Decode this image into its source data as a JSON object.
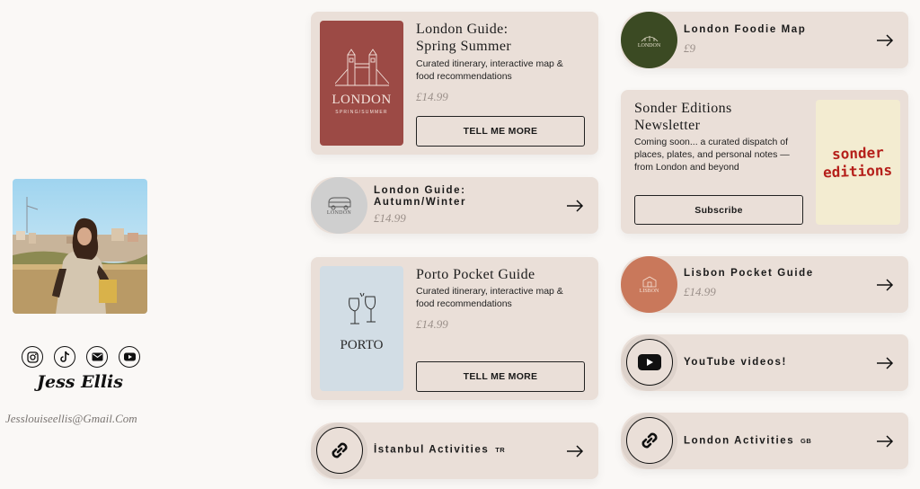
{
  "profile": {
    "name": "Jess Ellis",
    "email": "Jesslouiseellis@Gmail.Com",
    "socials": [
      "instagram-icon",
      "tiktok-icon",
      "email-icon",
      "youtube-icon"
    ]
  },
  "cards": {
    "london_ss": {
      "title_line1": "London Guide:",
      "title_line2": "Spring Summer",
      "description": "Curated itinerary, interactive map & food recommendations",
      "price": "£14.99",
      "button": "TELL ME MORE",
      "image_text": "LONDON",
      "image_subtext": "SPRING/SUMMER"
    },
    "london_aw": {
      "title_line1": "London Guide:",
      "title_line2": "Autumn/Winter",
      "price": "£14.99",
      "image_text": "LONDON"
    },
    "porto": {
      "title": "Porto Pocket Guide",
      "description": "Curated itinerary, interactive map & food recommendations",
      "price": "£14.99",
      "button": "TELL ME MORE",
      "image_text": "PORTO"
    },
    "istanbul": {
      "title": "İstanbul Activities",
      "tag": "TR"
    },
    "foodie": {
      "title": "London Foodie Map",
      "price": "£9",
      "image_text": "LONDON"
    },
    "newsletter": {
      "title_line1": "Sonder Editions",
      "title_line2": "Newsletter",
      "description": "Coming soon... a curated dispatch of places, plates, and personal notes — from London and beyond",
      "button": "Subscribe",
      "image_line1": "sonder",
      "image_line2": "editions"
    },
    "lisbon": {
      "title": "Lisbon Pocket Guide",
      "price": "£14.99",
      "image_text": "LISBON"
    },
    "youtube": {
      "title": "YouTube videos!"
    },
    "london_act": {
      "title": "London Activities",
      "tag": "GB"
    }
  },
  "colors": {
    "card_bg": "#eadfd8",
    "page_bg": "#faf8f6",
    "london_red": "#9c4a45",
    "foodie_green": "#3b4a23",
    "lisbon_terracotta": "#c9785b",
    "porto_blue": "#d2dde5",
    "sonder_cream": "#f3ecd1",
    "sonder_red": "#b51f1a"
  }
}
